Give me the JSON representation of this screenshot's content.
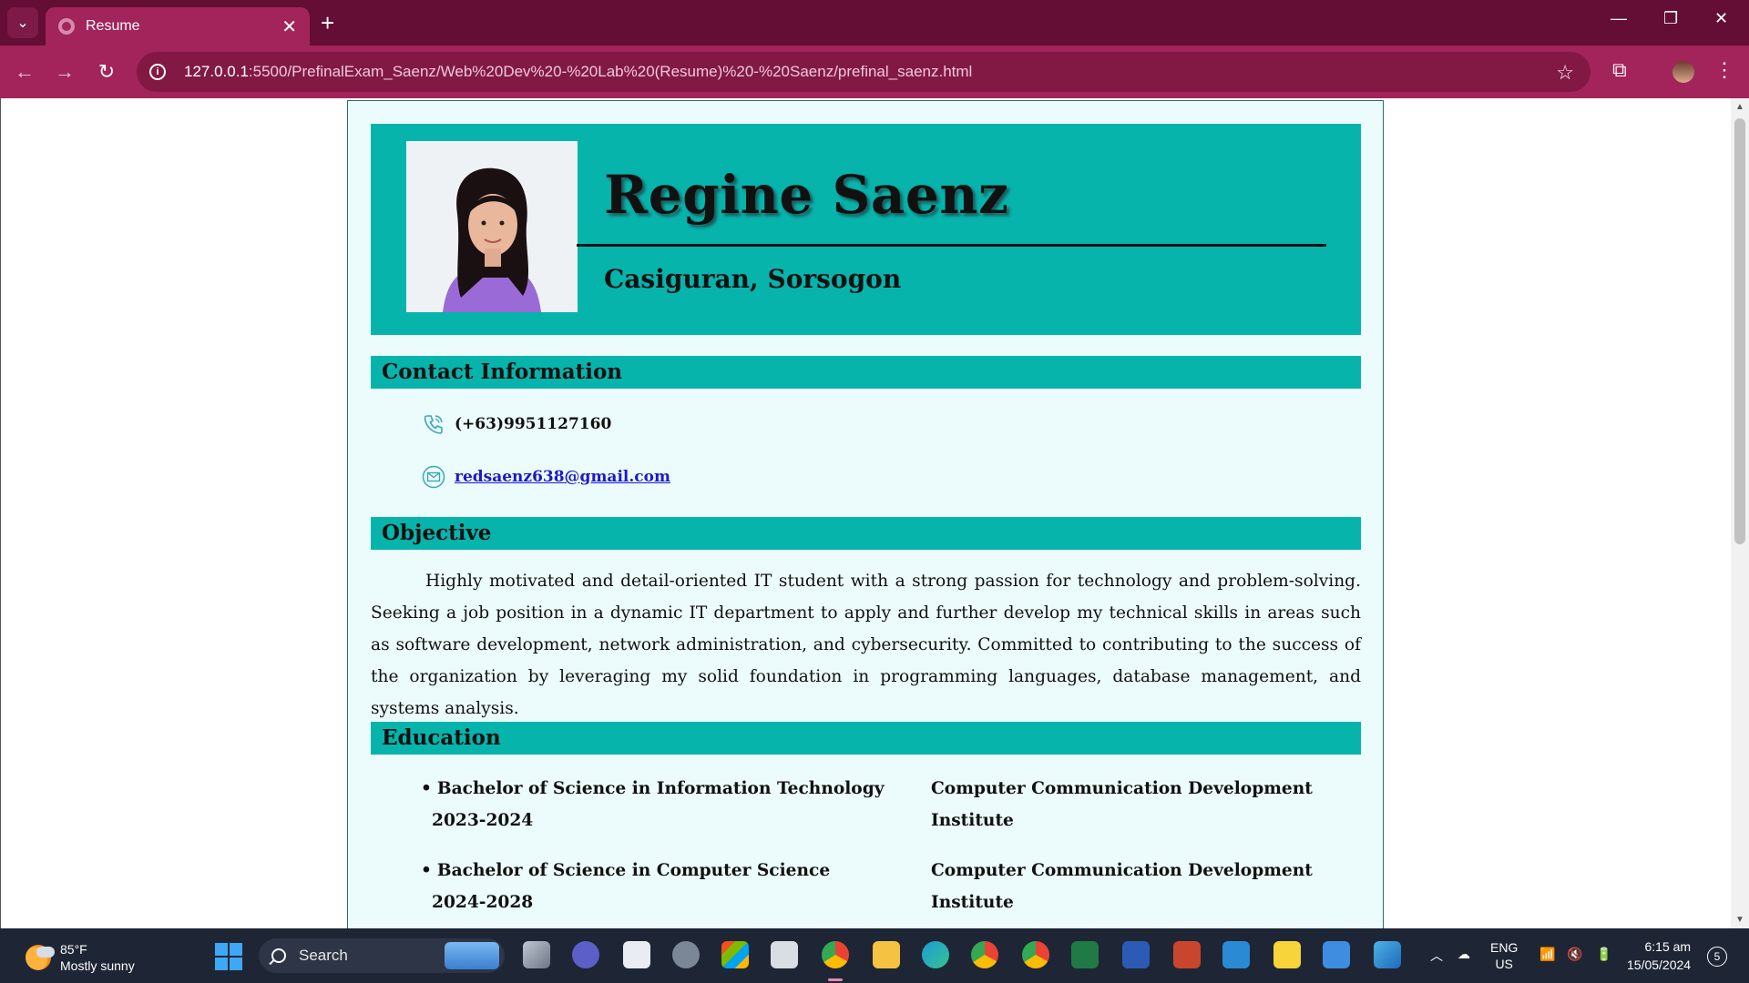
{
  "browser": {
    "tab_title": "Resume",
    "tab_close": "✕",
    "new_tab": "+",
    "url_host": "127.0.0.1",
    "url_path": ":5500/PrefinalExam_Saenz/Web%20Dev%20-%20Lab%20(Resume)%20-%20Saenz/prefinal_saenz.html"
  },
  "resume": {
    "name": "Regine Saenz",
    "location": "Casiguran, Sorsogon",
    "sections": {
      "contact": "Contact Information",
      "objective": "Objective",
      "education": "Education"
    },
    "contact": {
      "phone": "(+63)9951127160",
      "email": "redsaenz638@gmail.com"
    },
    "objective_text": "Highly motivated and detail-oriented IT student with a strong passion for technology and problem-solving. Seeking a job position in a dynamic IT department to apply and further develop my technical skills in areas such as software development, network administration, and cybersecurity. Committed to contributing to the success of the organization by leveraging my solid foundation in programming languages, database management, and systems analysis.",
    "education": [
      {
        "degree": "Bachelor of Science in Information Technology",
        "year": "2023-2024",
        "school": "Computer Communication Development Institute"
      },
      {
        "degree": "Bachelor of Science in Computer Science",
        "year": "2024-2028",
        "school": "Computer Communication Development Institute"
      }
    ],
    "colors": {
      "accent": "#06b4ac",
      "page_bg": "#ecfbfb",
      "link": "#1a1ac8"
    }
  },
  "taskbar": {
    "temperature": "85°F",
    "weather": "Mostly sunny",
    "search_placeholder": "Search",
    "lang_top": "ENG",
    "lang_bottom": "US",
    "time": "6:15 am",
    "date": "15/05/2024",
    "notifications": "5"
  }
}
